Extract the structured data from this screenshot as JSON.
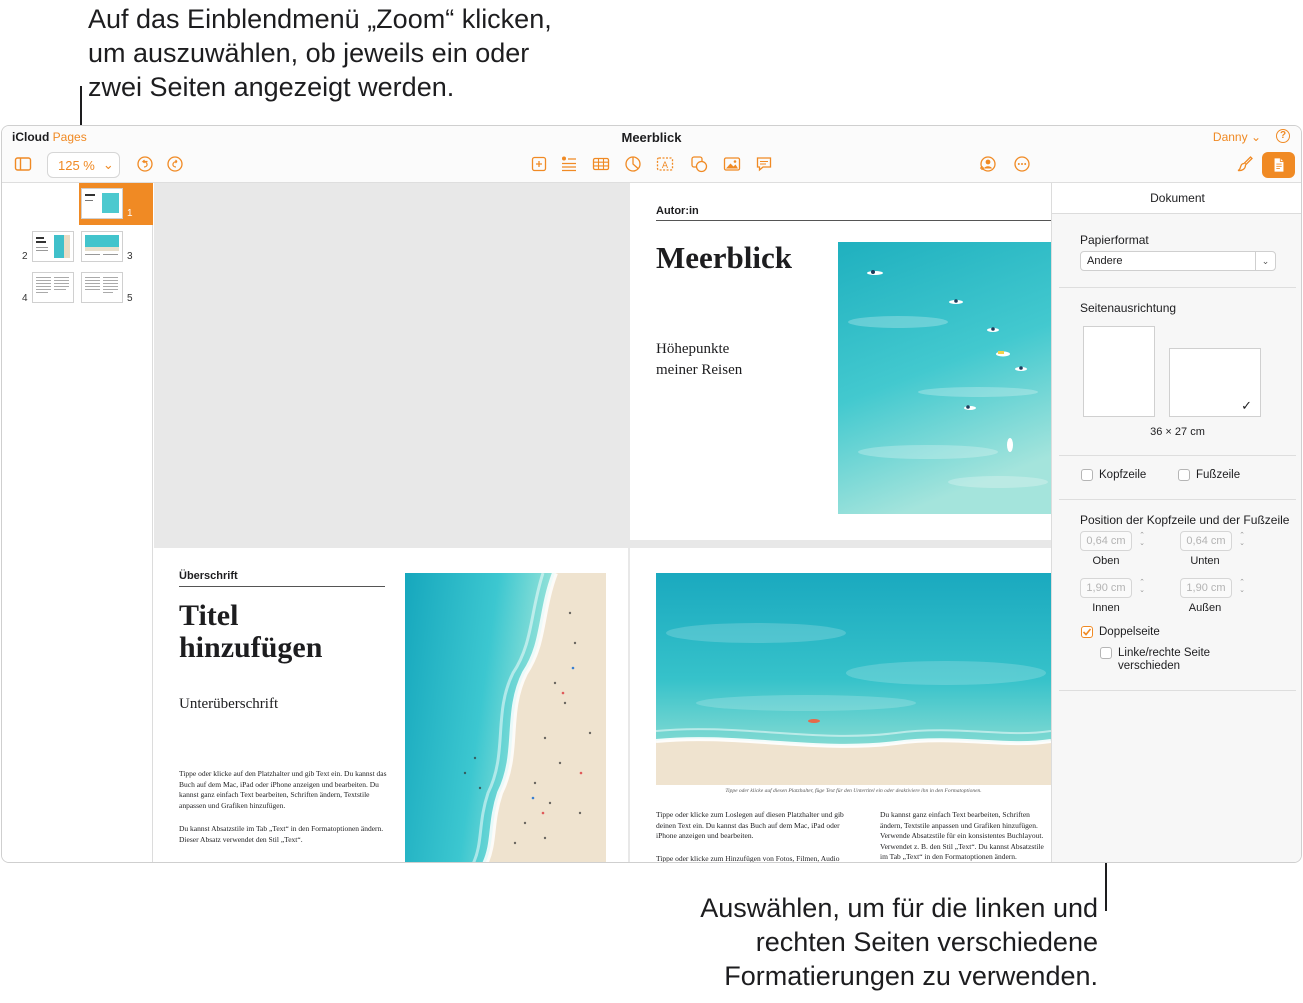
{
  "callouts": {
    "top": [
      "Auf das Einblendmenü „Zoom“ klicken,",
      "um auszuwählen, ob jeweils ein oder",
      "zwei Seiten angezeigt werden."
    ],
    "bottom": [
      "Auswählen, um für die linken und",
      "rechten Seiten verschiedene",
      "Formatierungen zu verwenden."
    ]
  },
  "app": {
    "brand_icloud": "iCloud",
    "brand_pages": "Pages",
    "document_title": "Meerblick",
    "user": "Danny",
    "help": "?"
  },
  "toolbar": {
    "zoom_value": "125 %",
    "icons": [
      "sidebar-icon",
      "undo-icon",
      "redo-icon",
      "insert-icon",
      "text-list-icon",
      "table-icon",
      "chart-icon",
      "text-box-icon",
      "shape-icon",
      "media-icon",
      "comment-icon",
      "collaborate-icon",
      "more-icon",
      "format-brush-icon",
      "document-icon"
    ]
  },
  "thumbnails": {
    "page_numbers": [
      "1",
      "2",
      "3",
      "4",
      "5"
    ],
    "selected": "1"
  },
  "pages": {
    "cover": {
      "author_label": "Autor:in",
      "title": "Meerblick",
      "subtitle_line1": "Höhepunkte",
      "subtitle_line2": "meiner Reisen"
    },
    "left": {
      "heading_label": "Überschrift",
      "title_line1": "Titel",
      "title_line2": "hinzufügen",
      "subheading": "Unterüberschrift",
      "body1": "Tippe oder klicke auf den Platzhalter und gib Text ein. Du kannst das Buch auf dem Mac, iPad oder iPhone anzeigen und bearbeiten. Du kannst ganz einfach Text bearbeiten, Schriften ändern, Textstile anpassen und Grafiken hinzufügen.",
      "body2": "Du kannst Absatzstile im Tab „Text“ in den Formatoptionen ändern. Dieser Absatz verwendet den Stil „Text“."
    },
    "right": {
      "caption": "Tippe oder klicke auf diesen Platzhalter, füge Text für den Untertitel ein oder deaktiviere ihn in den Formatoptionen.",
      "col1": "Tippe oder klicke zum Loslegen auf diesen Platzhalter und gib deinen Text ein. Du kannst das Buch auf dem Mac, iPad oder iPhone anzeigen und bearbeiten.",
      "col1b": "Tippe oder klicke zum Hinzufügen von Fotos, Filmen, Audio",
      "col2": "Du kannst ganz einfach Text bearbeiten, Schriften ändern, Textstile anpassen und Grafiken hinzufügen. Verwende Absatzstile für ein konsistentes Buchlayout. Verwendet z. B. den Stil „Text“. Du kannst Absatzstile im Tab „Text“ in den Formatoptionen ändern."
    }
  },
  "inspector": {
    "tab": "Dokument",
    "paper_label": "Papierformat",
    "paper_value": "Andere",
    "orientation_label": "Seitenausrichtung",
    "size_text": "36 × 27 cm",
    "header_label": "Kopfzeile",
    "footer_label": "Fußzeile",
    "header_checked": false,
    "footer_checked": false,
    "position_label": "Position der Kopfzeile und der Fußzeile",
    "top_value": "0,64 cm",
    "top_label": "Oben",
    "bottom_value": "0,64 cm",
    "bottom_label": "Unten",
    "inside_value": "1,90 cm",
    "inside_label": "Innen",
    "outside_value": "1,90 cm",
    "outside_label": "Außen",
    "facing_label": "Doppelseite",
    "facing_checked": true,
    "left_right_label_1": "Linke/rechte Seite",
    "left_right_label_2": "verschieden",
    "left_right_checked": false
  },
  "colors": {
    "accent": "#f08a24",
    "sea_light": "#7ee0dc",
    "sea_mid": "#2bbfc6",
    "sea_deep": "#139fb0",
    "sand": "#efe3cf"
  }
}
